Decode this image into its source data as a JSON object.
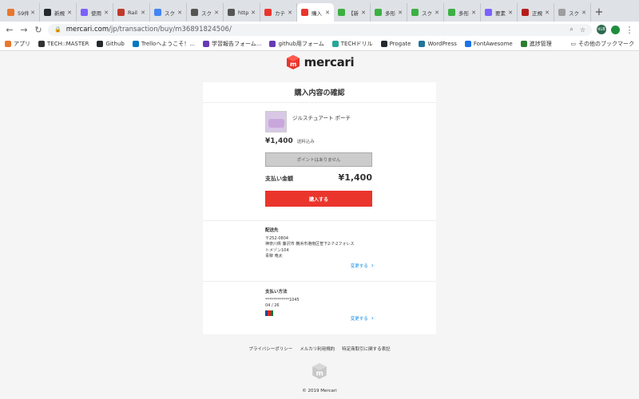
{
  "browser": {
    "tabs": [
      {
        "label": "59件",
        "color": "#e8772e"
      },
      {
        "label": "新規",
        "color": "#24292e"
      },
      {
        "label": "使用",
        "color": "#7b61ff"
      },
      {
        "label": "Rail",
        "color": "#c0392b"
      },
      {
        "label": "スク",
        "color": "#4285f4"
      },
      {
        "label": "スク",
        "color": "#555555"
      },
      {
        "label": "http",
        "color": "#555555"
      },
      {
        "label": "カテ",
        "color": "#ea352d"
      },
      {
        "label": "購入",
        "color": "#ea352d",
        "active": true
      },
      {
        "label": "【新",
        "color": "#3cb043"
      },
      {
        "label": "多形",
        "color": "#3cb043"
      },
      {
        "label": "スク",
        "color": "#3cb043"
      },
      {
        "label": "多形",
        "color": "#3cb043"
      },
      {
        "label": "要素",
        "color": "#7b61ff"
      },
      {
        "label": "正規",
        "color": "#b71c1c"
      },
      {
        "label": "スク",
        "color": "#9e9e9e"
      }
    ],
    "url_domain": "mercari.com",
    "url_path": "/jp/transaction/buy/m36891824506/",
    "profile_initials": "dLB",
    "bookmarks": [
      {
        "label": "アプリ",
        "color": "#e8772e"
      },
      {
        "label": "TECH::MASTER",
        "color": "#333333"
      },
      {
        "label": "Github",
        "color": "#24292e"
      },
      {
        "label": "Trelloへようこそ！...",
        "color": "#0079bf"
      },
      {
        "label": "学習報告フォーム...",
        "color": "#673ab7"
      },
      {
        "label": "github用フォーム",
        "color": "#673ab7"
      },
      {
        "label": "TECHドリル",
        "color": "#26a69a"
      },
      {
        "label": "Progate",
        "color": "#24292e"
      },
      {
        "label": "WordPress",
        "color": "#21759b"
      },
      {
        "label": "FontAwesome",
        "color": "#1a73e8"
      },
      {
        "label": "進捗管理",
        "color": "#2e7d32"
      }
    ],
    "other_bookmarks": "その他のブックマーク"
  },
  "page": {
    "logo_text": "mercari",
    "card_title": "購入内容の確認",
    "item_name": "ジルスチュアート ポーチ",
    "price": "¥1,400",
    "shipping_note": "送料込み",
    "points_button": "ポイントはありません",
    "total_label": "支払い金額",
    "total_value": "¥1,400",
    "buy_button": "購入する",
    "shipping": {
      "title": "配送先",
      "lines": [
        "〒252-0804",
        "神奈川県 藤沢市 横浜市港南区笹下2-7-2フォレス",
        "トメゾン104",
        "青柳 竜太"
      ],
      "change": "変更する"
    },
    "payment": {
      "title": "支払い方法",
      "card_number": "************1045",
      "expiry": "04 / 26",
      "change": "変更する"
    },
    "footer_links": [
      "プライバシーポリシー",
      "メルカリ利用規約",
      "特定商取引に関する表記"
    ],
    "copyright": "© 2019 Mercari"
  },
  "colors": {
    "brand_red": "#ea352d",
    "link_blue": "#0f8ee6"
  }
}
